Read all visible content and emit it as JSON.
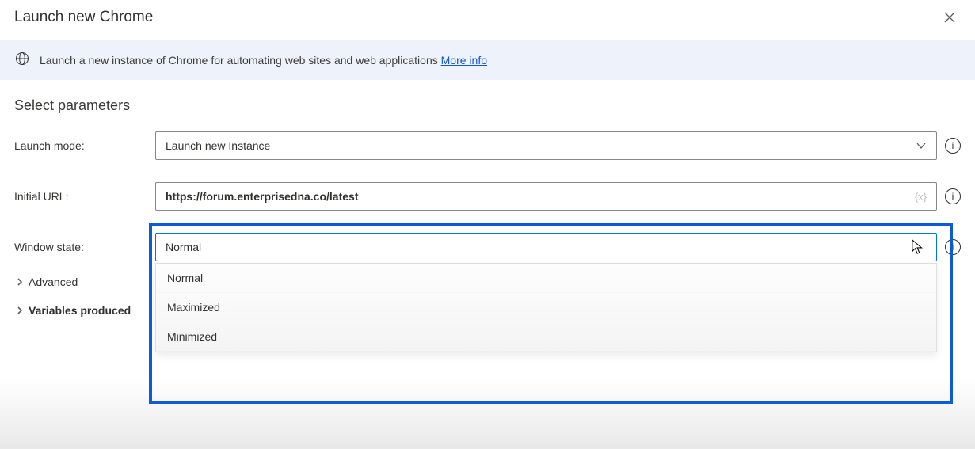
{
  "dialog": {
    "title": "Launch new Chrome"
  },
  "banner": {
    "text": "Launch a new instance of Chrome for automating web sites and web applications ",
    "link": "More info"
  },
  "section": {
    "title": "Select parameters"
  },
  "fields": {
    "launch_mode": {
      "label": "Launch mode:",
      "value": "Launch new Instance"
    },
    "initial_url": {
      "label": "Initial URL:",
      "value": "https://forum.enterprisedna.co/latest",
      "var_token": "{x}"
    },
    "window_state": {
      "label": "Window state:",
      "value": "Normal",
      "options": [
        "Normal",
        "Maximized",
        "Minimized"
      ]
    }
  },
  "expanders": {
    "advanced": "Advanced",
    "variables": "Variables produced"
  },
  "icons": {
    "info": "i"
  }
}
